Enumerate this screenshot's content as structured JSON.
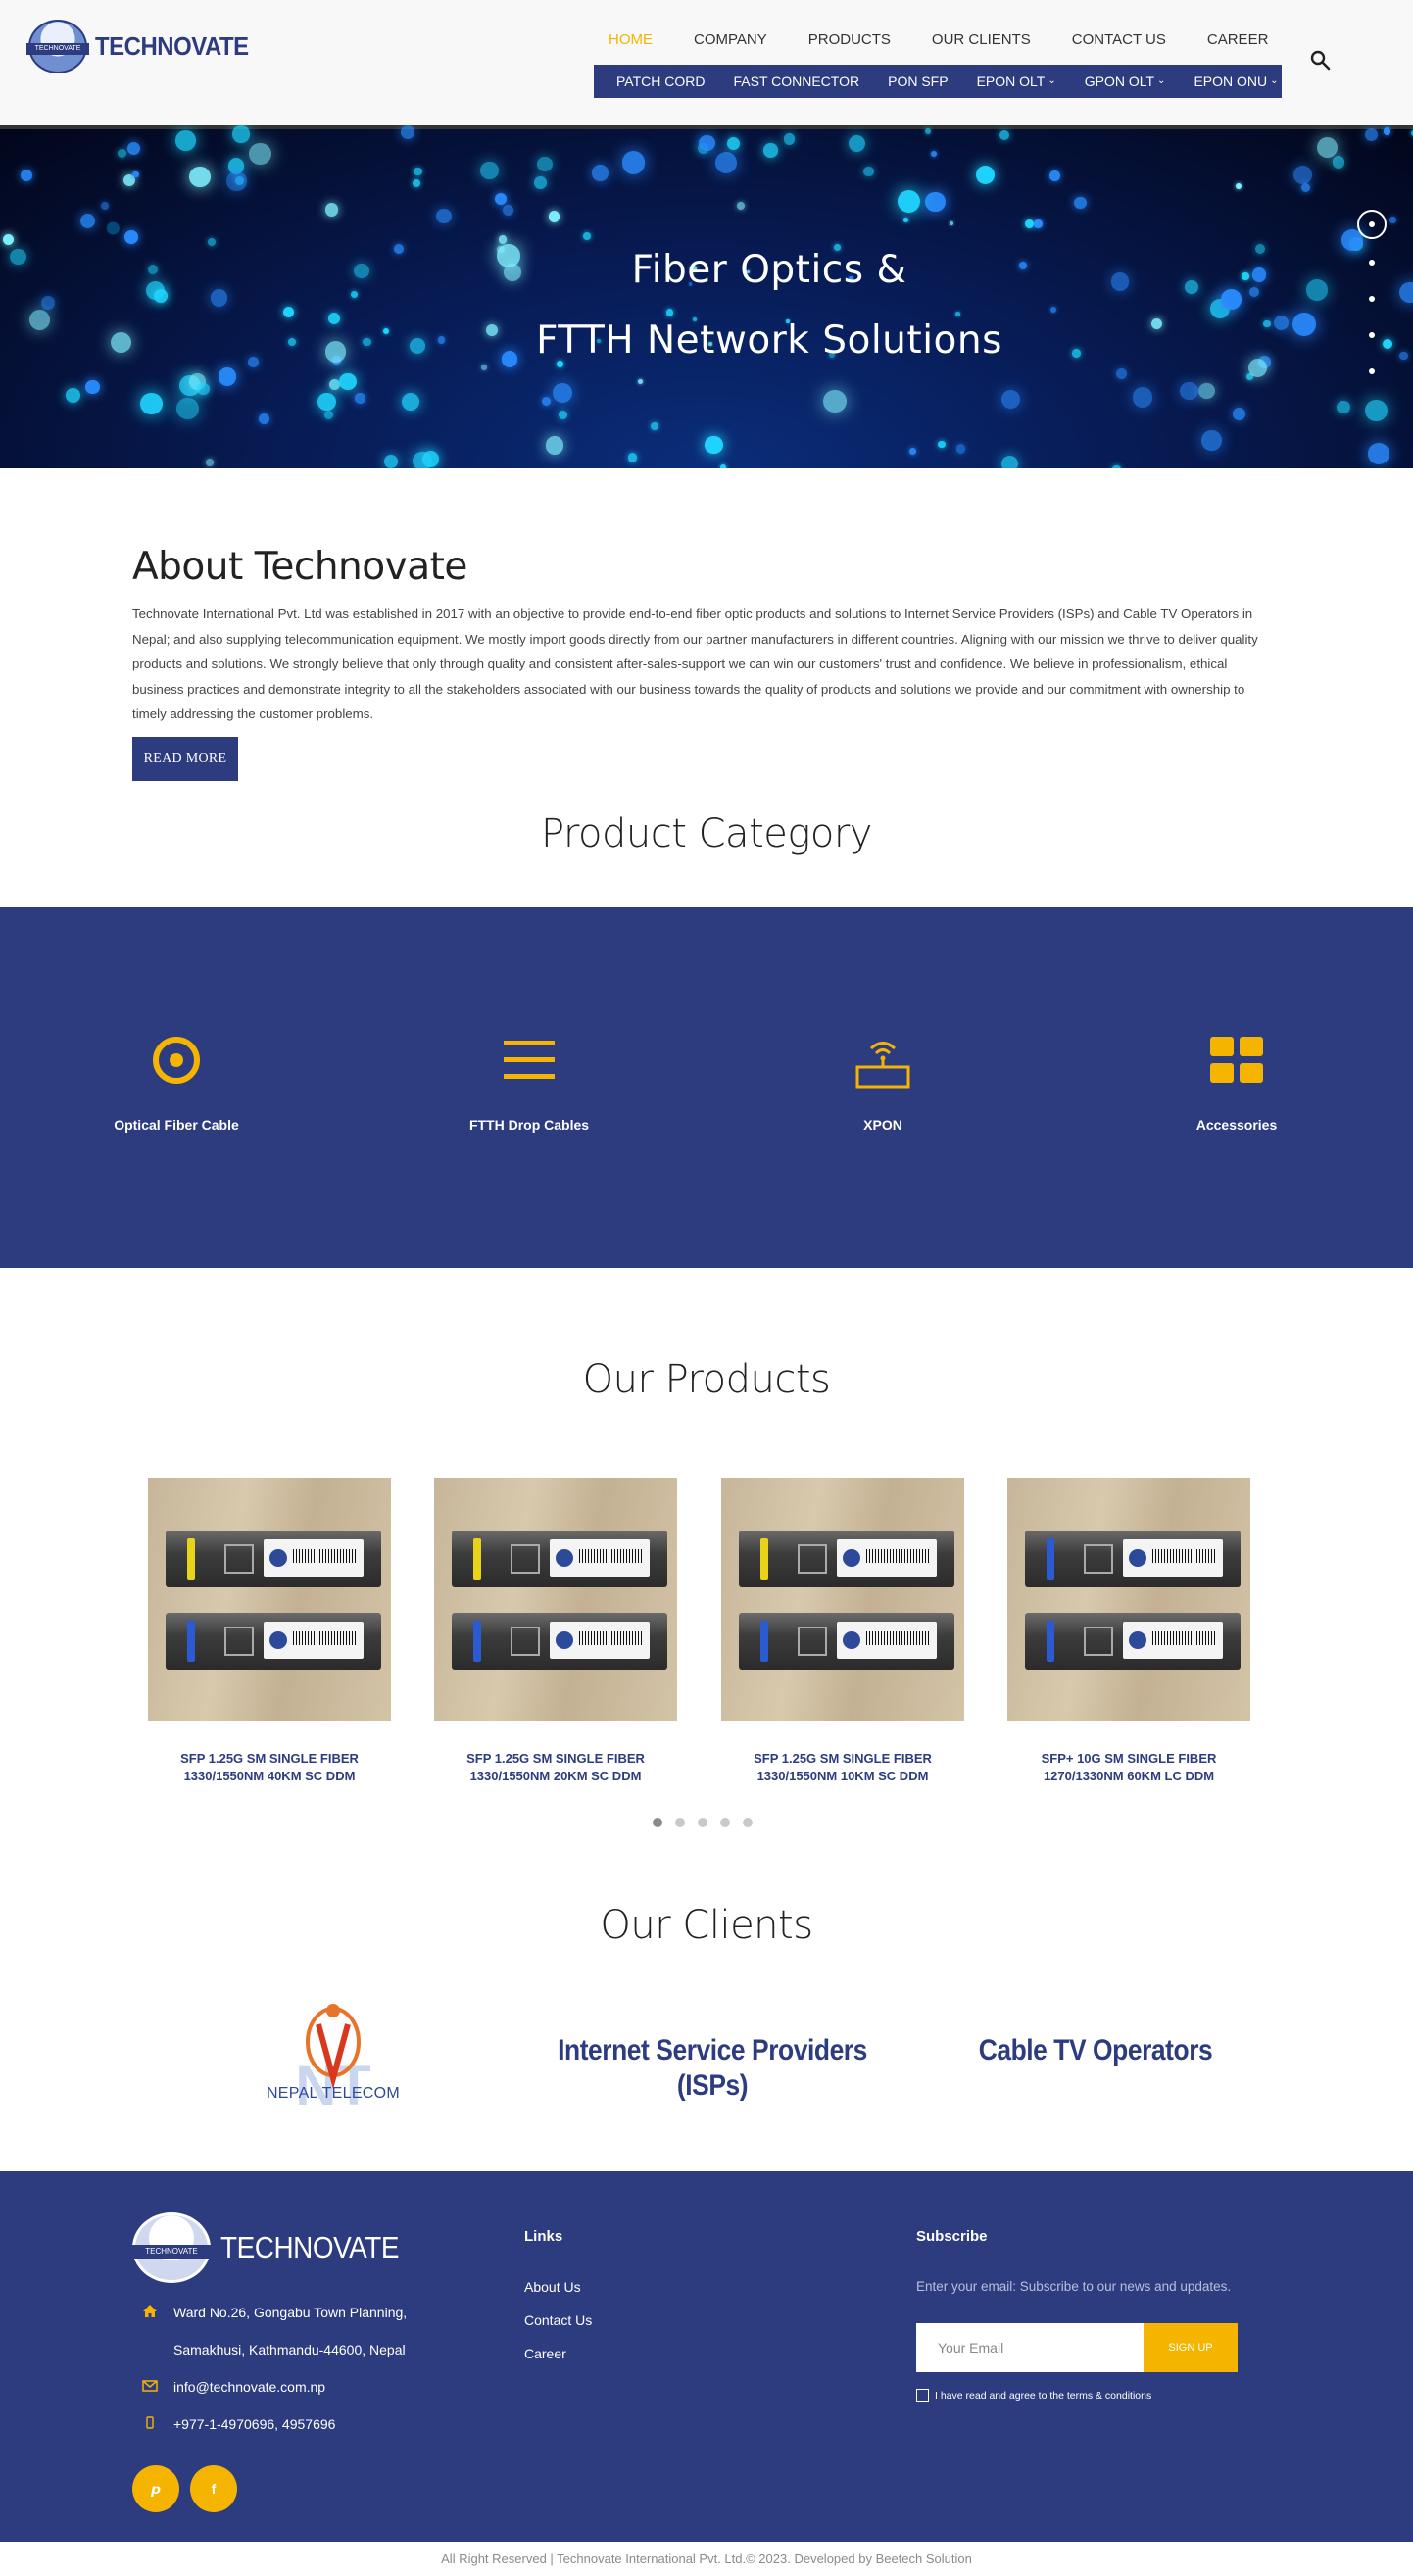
{
  "brand": {
    "name": "TECHNOVATE",
    "badge_text": "TECHNOVATE"
  },
  "nav": {
    "top": [
      "HOME",
      "COMPANY",
      "PRODUCTS",
      "OUR CLIENTS",
      "CONTACT US",
      "CAREER"
    ],
    "active": "HOME",
    "sub": [
      {
        "label": "PATCH CORD",
        "dropdown": false
      },
      {
        "label": "FAST CONNECTOR",
        "dropdown": false
      },
      {
        "label": "PON SFP",
        "dropdown": false
      },
      {
        "label": "EPON OLT",
        "dropdown": true
      },
      {
        "label": "GPON OLT",
        "dropdown": true
      },
      {
        "label": "EPON ONU",
        "dropdown": true
      }
    ],
    "search_icon": "search-icon"
  },
  "hero": {
    "line1": "Fiber Optics &",
    "line2": "FTTH Network Solutions",
    "slide_count": 5,
    "active_slide": 1
  },
  "about": {
    "title": "About Technovate",
    "body": "Technovate International Pvt. Ltd was established in 2017 with an objective to provide end-to-end fiber optic products and solutions to Internet Service Providers (ISPs) and Cable TV Operators in Nepal; and also supplying telecommunication equipment. We mostly import goods directly from our partner manufacturers in different countries. Aligning with our mission we thrive to deliver quality products and solutions. We strongly believe that only through quality and consistent after-sales-support we can win our customers' trust and confidence. We believe in professionalism, ethical business practices and demonstrate integrity to all the stakeholders associated with our business towards the quality of products and solutions we provide and our commitment with ownership to timely addressing the customer problems.",
    "button": "READ MORE"
  },
  "categories": {
    "title": "Product Category",
    "items": [
      {
        "label": "Optical Fiber Cable",
        "icon": "target-icon"
      },
      {
        "label": "FTTH Drop Cables",
        "icon": "menu-lines-icon"
      },
      {
        "label": "XPON",
        "icon": "router-icon"
      },
      {
        "label": "Accessories",
        "icon": "grid-icon"
      }
    ]
  },
  "products": {
    "title": "Our Products",
    "items": [
      {
        "name": "SFP 1.25G SM SINGLE FIBER 1330/1550NM 40KM SC DDM",
        "latch_colors": [
          "#e8d21a",
          "#2a5bd0"
        ]
      },
      {
        "name": "SFP 1.25G SM SINGLE FIBER 1330/1550NM 20KM SC DDM",
        "latch_colors": [
          "#e8d21a",
          "#2a5bd0"
        ]
      },
      {
        "name": "SFP 1.25G SM SINGLE FIBER 1330/1550NM 10KM SC DDM",
        "latch_colors": [
          "#e8d21a",
          "#2a5bd0"
        ]
      },
      {
        "name": "SFP+ 10G SM SINGLE FIBER 1270/1330NM 60KM LC DDM",
        "latch_colors": [
          "#2a5bd0",
          "#2a5bd0"
        ]
      }
    ],
    "carousel_pages": 5,
    "carousel_active": 1
  },
  "clients": {
    "title": "Our Clients",
    "items": [
      {
        "name": "NEPAL TELECOM",
        "type": "logo"
      },
      {
        "name": "Internet Service Providers (ISPs)",
        "type": "text"
      },
      {
        "name": "Cable TV Operators",
        "type": "text"
      }
    ]
  },
  "footer": {
    "brand": "TECHNOVATE",
    "address_line1": "Ward No.26, Gongabu Town Planning,",
    "address_line2": "Samakhusi, Kathmandu-44600, Nepal",
    "email": "info@technovate.com.np",
    "phone": "+977-1-4970696, 4957696",
    "links_title": "Links",
    "links": [
      "About Us",
      "Contact Us",
      "Career"
    ],
    "subscribe_title": "Subscribe",
    "subscribe_desc": "Enter your email: Subscribe to our news and updates.",
    "email_placeholder": "Your Email",
    "signup": "SIGN UP",
    "agree": "I have read and agree to the terms & conditions",
    "social": [
      "twitter-icon",
      "facebook-icon"
    ]
  },
  "copyright": "All Right Reserved | Technovate International Pvt. Ltd.© 2023. Developed by Beetech Solution",
  "colors": {
    "primary": "#2d3c7f",
    "accent": "#f5b400"
  }
}
